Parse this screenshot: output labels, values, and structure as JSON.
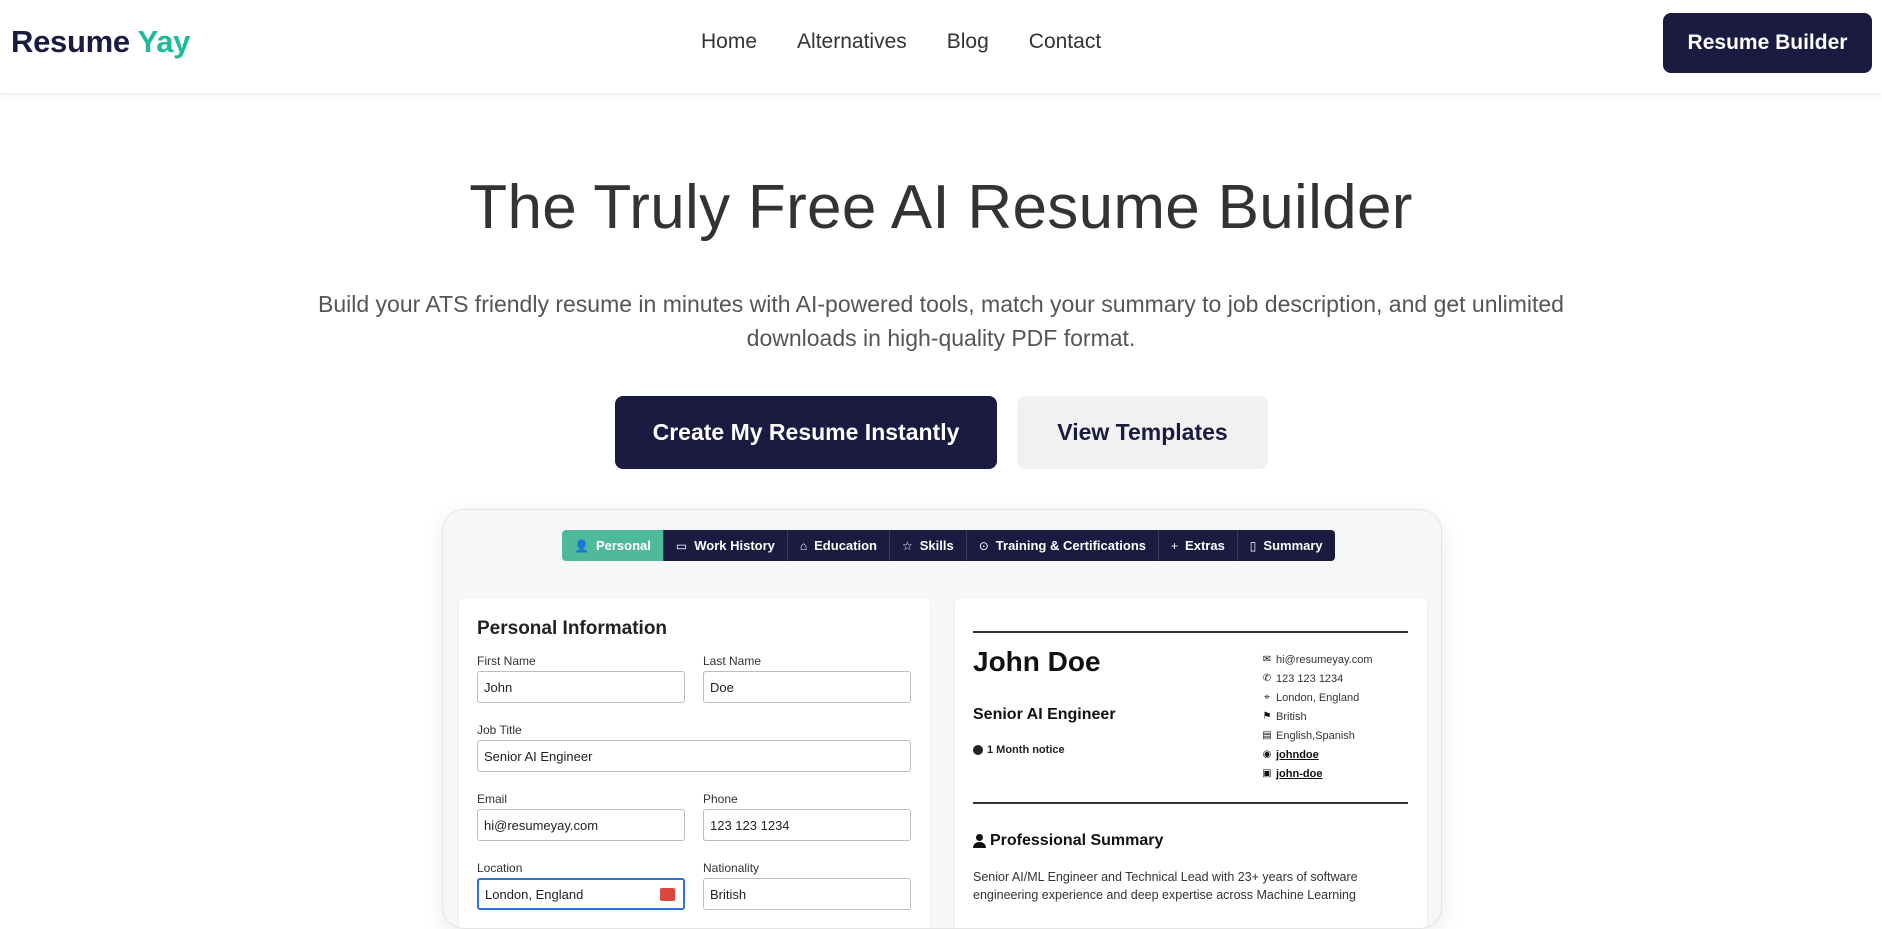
{
  "header": {
    "logo_part1": "Resume",
    "logo_part2": "Yay",
    "nav": [
      "Home",
      "Alternatives",
      "Blog",
      "Contact"
    ],
    "cta": "Resume Builder"
  },
  "hero": {
    "title": "The Truly Free AI Resume Builder",
    "subtitle": "Build your ATS friendly resume in minutes with AI-powered tools, match your summary to job description, and get unlimited downloads in high-quality PDF format.",
    "primary_button": "Create My Resume Instantly",
    "secondary_button": "View Templates"
  },
  "preview": {
    "tabs": [
      {
        "label": "Personal",
        "icon": "person-icon",
        "glyph": "👤",
        "active": true
      },
      {
        "label": "Work History",
        "icon": "briefcase-icon",
        "glyph": "▭",
        "active": false
      },
      {
        "label": "Education",
        "icon": "graduation-cap-icon",
        "glyph": "⌂",
        "active": false
      },
      {
        "label": "Skills",
        "icon": "star-icon",
        "glyph": "☆",
        "active": false
      },
      {
        "label": "Training & Certifications",
        "icon": "badge-check-icon",
        "glyph": "⊙",
        "active": false
      },
      {
        "label": "Extras",
        "icon": "plus-icon",
        "glyph": "+",
        "active": false
      },
      {
        "label": "Summary",
        "icon": "document-icon",
        "glyph": "▯",
        "active": false
      }
    ],
    "form": {
      "title": "Personal Information",
      "first_name_label": "First Name",
      "first_name": "John",
      "last_name_label": "Last Name",
      "last_name": "Doe",
      "job_title_label": "Job Title",
      "job_title": "Senior AI Engineer",
      "email_label": "Email",
      "email": "hi@resumeyay.com",
      "phone_label": "Phone",
      "phone": "123 123 1234",
      "location_label": "Location",
      "location": "London, England",
      "nationality_label": "Nationality",
      "nationality": "British"
    },
    "resume": {
      "name": "John Doe",
      "title": "Senior AI Engineer",
      "notice": "1 Month notice",
      "contacts": [
        {
          "icon": "envelope-icon",
          "glyph": "✉",
          "text": "hi@resumeyay.com",
          "link": false
        },
        {
          "icon": "phone-icon",
          "glyph": "✆",
          "text": "123 123 1234",
          "link": false
        },
        {
          "icon": "map-pin-icon",
          "glyph": "⌖",
          "text": "London, England",
          "link": false
        },
        {
          "icon": "flag-icon",
          "glyph": "⚑",
          "text": "British",
          "link": false
        },
        {
          "icon": "language-icon",
          "glyph": "▤",
          "text": "English,Spanish",
          "link": false
        },
        {
          "icon": "github-icon",
          "glyph": "◉",
          "text": "johndoe",
          "link": true
        },
        {
          "icon": "linkedin-icon",
          "glyph": "▣",
          "text": "john-doe",
          "link": true
        }
      ],
      "section_title": "Professional Summary",
      "summary": "Senior AI/ML Engineer and Technical Lead with 23+ years of software engineering experience and deep expertise across Machine Learning"
    }
  }
}
